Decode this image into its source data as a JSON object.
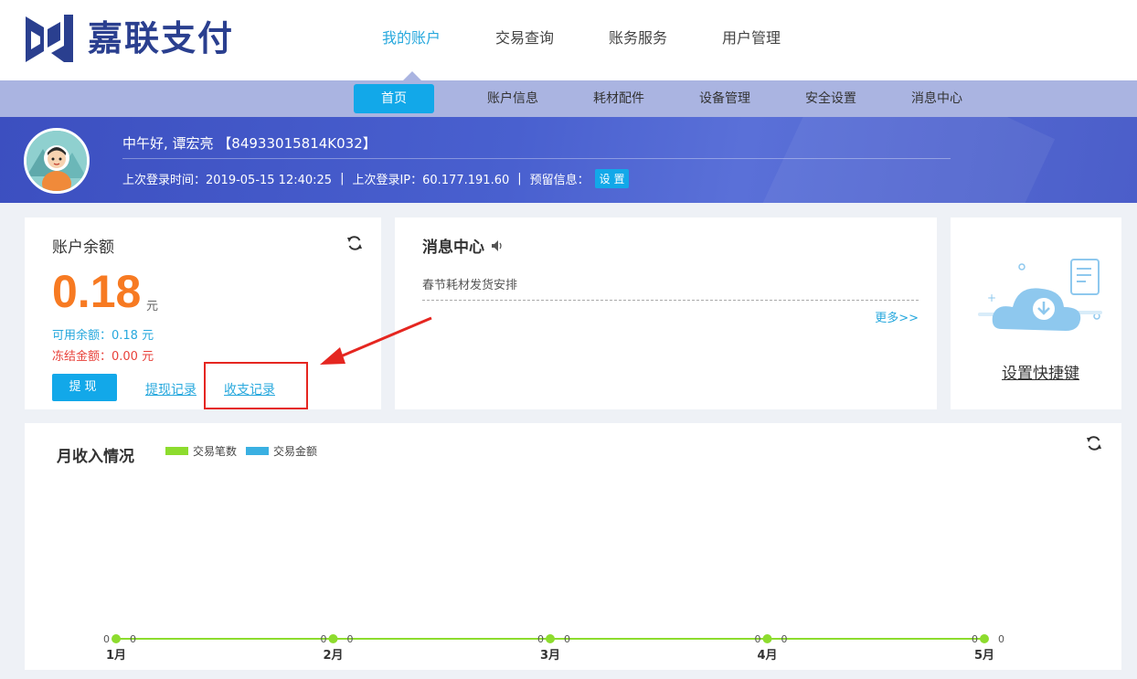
{
  "brand": {
    "name": "嘉联支付"
  },
  "topnav": [
    {
      "label": "我的账户",
      "active": true
    },
    {
      "label": "交易查询",
      "active": false
    },
    {
      "label": "账务服务",
      "active": false
    },
    {
      "label": "用户管理",
      "active": false
    }
  ],
  "subnav": [
    {
      "label": "首页",
      "active": true
    },
    {
      "label": "账户信息",
      "active": false
    },
    {
      "label": "耗材配件",
      "active": false
    },
    {
      "label": "设备管理",
      "active": false
    },
    {
      "label": "安全设置",
      "active": false
    },
    {
      "label": "消息中心",
      "active": false
    }
  ],
  "user": {
    "greeting": "中午好, 谭宏亮 【84933015814K032】",
    "last_login_time": "上次登录时间：2019-05-15 12:40:25",
    "last_login_ip": "上次登录IP：60.177.191.60",
    "reserved_info": "预留信息：",
    "set_button": "设 置",
    "separator": "|"
  },
  "balance": {
    "title": "账户余额",
    "amount": "0.18",
    "unit": "元",
    "available": "可用余额：0.18 元",
    "frozen": "冻结金额：0.00 元",
    "withdraw_button": "提现",
    "withdraw_records": "提现记录",
    "income_records": "收支记录"
  },
  "messages": {
    "title": "消息中心",
    "items": [
      "春节耗材发货安排"
    ],
    "more": "更多>>"
  },
  "shortcut": {
    "label": "设置快捷键"
  },
  "colors": {
    "accent": "#12a8e9",
    "banner": "#4960cf",
    "orange": "#f77a22",
    "red": "#e8413a",
    "series_count": "#8ddc2e",
    "series_amount": "#3ab0e2"
  },
  "chart_data": {
    "type": "line",
    "title": "月收入情况",
    "categories": [
      "1月",
      "2月",
      "3月",
      "4月",
      "5月"
    ],
    "series": [
      {
        "name": "交易笔数",
        "values": [
          0,
          0,
          0,
          0,
          0
        ]
      },
      {
        "name": "交易金额",
        "values": [
          0,
          0,
          0,
          0,
          0
        ]
      }
    ],
    "legend_position": "top-left"
  }
}
